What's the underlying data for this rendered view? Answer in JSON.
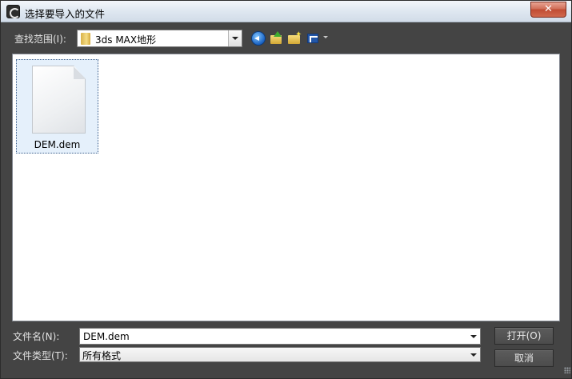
{
  "window": {
    "title": "选择要导入的文件",
    "close_label": "✕"
  },
  "toolbar": {
    "lookin_label": "查找范围(I):",
    "lookin_value": "3ds MAX地形",
    "icons": [
      "back-icon",
      "up-folder-icon",
      "new-folder-icon",
      "view-menu-icon"
    ]
  },
  "file_list": {
    "items": [
      {
        "name": "DEM.dem",
        "icon": "document-icon",
        "selected": true
      }
    ]
  },
  "bottom": {
    "filename_label": "文件名(N):",
    "filename_value": "DEM.dem",
    "filetype_label": "文件类型(T):",
    "filetype_value": "所有格式",
    "open_label": "打开(O)",
    "cancel_label": "取消"
  }
}
